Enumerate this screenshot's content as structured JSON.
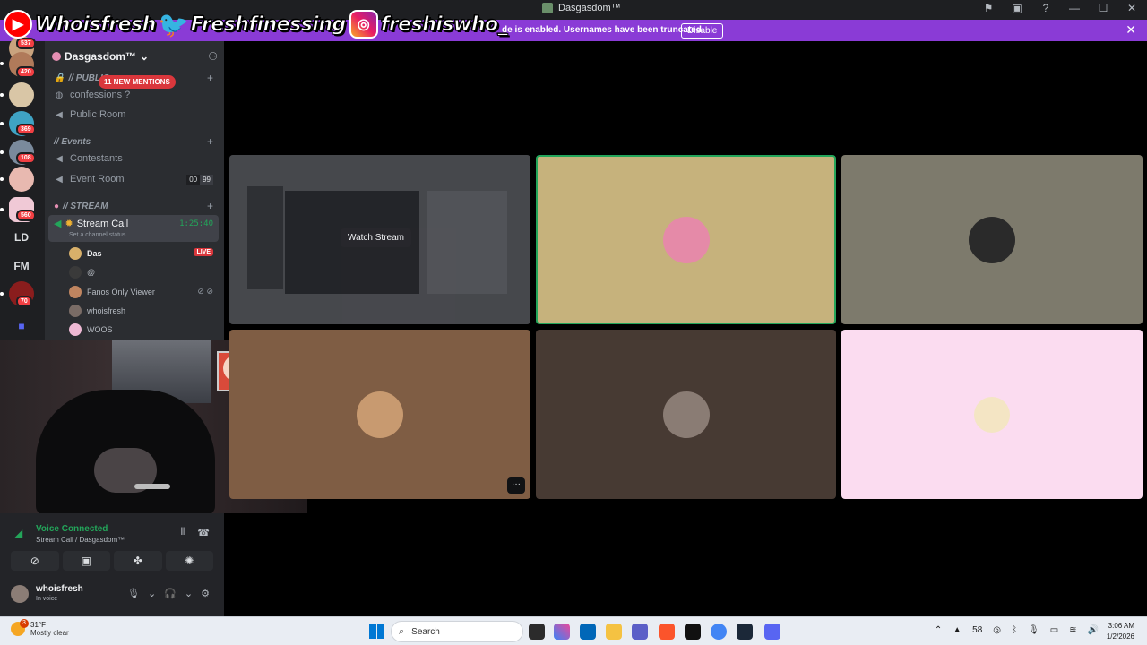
{
  "window": {
    "title": "Dasgasdom™",
    "controls": [
      "flag-icon",
      "inbox-icon",
      "help-icon",
      "minimize",
      "maximize",
      "close"
    ]
  },
  "notice": {
    "text": "de is enabled. Usernames have been truncated.",
    "button": "Disable",
    "close": "✕"
  },
  "overlay": {
    "youtube": "Whoisfresh",
    "twitter": "Freshfinessing",
    "instagram": "freshiswho_"
  },
  "servers": [
    {
      "badge": "537"
    },
    {
      "badge": "420"
    },
    {
      "badge": ""
    },
    {
      "badge": "369"
    },
    {
      "badge": "108"
    },
    {
      "badge": ""
    },
    {
      "badge": "560"
    },
    {
      "text": "LD"
    },
    {
      "text": "FM"
    },
    {
      "badge": "70"
    }
  ],
  "guild": {
    "name": "Dasgasdom™",
    "chevron": "⌄",
    "mentions": "11 NEW MENTIONS",
    "categories": {
      "public": "// PUBLIC",
      "events": "// Events",
      "stream": "// STREAM"
    },
    "channels": {
      "confessions": "confessions ?",
      "public_room": "Public Room",
      "contestants": "Contestants",
      "event_room": "Event Room",
      "event_room_count": "00",
      "event_room_limit": "99",
      "stream_call": "Stream Call",
      "stream_call_time": "1:25:40",
      "stream_call_status": "Set a channel status"
    },
    "members": [
      {
        "name": "Das",
        "live": "LIVE"
      },
      {
        "name": "@"
      },
      {
        "name": "Fanos Only Viewer"
      },
      {
        "name": "whoisfresh"
      },
      {
        "name": "WOOS"
      }
    ]
  },
  "voice": {
    "title": "Voice Connected",
    "sub": "Stream Call / Dasgasdom™"
  },
  "user": {
    "name": "whoisfresh",
    "status": "In voice"
  },
  "grid": {
    "watch_stream": "Watch Stream",
    "more": "···"
  },
  "taskbar": {
    "temp": "31°F",
    "weather": "Mostly clear",
    "weather_badge": "3",
    "search": "Search",
    "time": "3:06 AM",
    "date": "1/2/2026",
    "tray_num": "58"
  }
}
